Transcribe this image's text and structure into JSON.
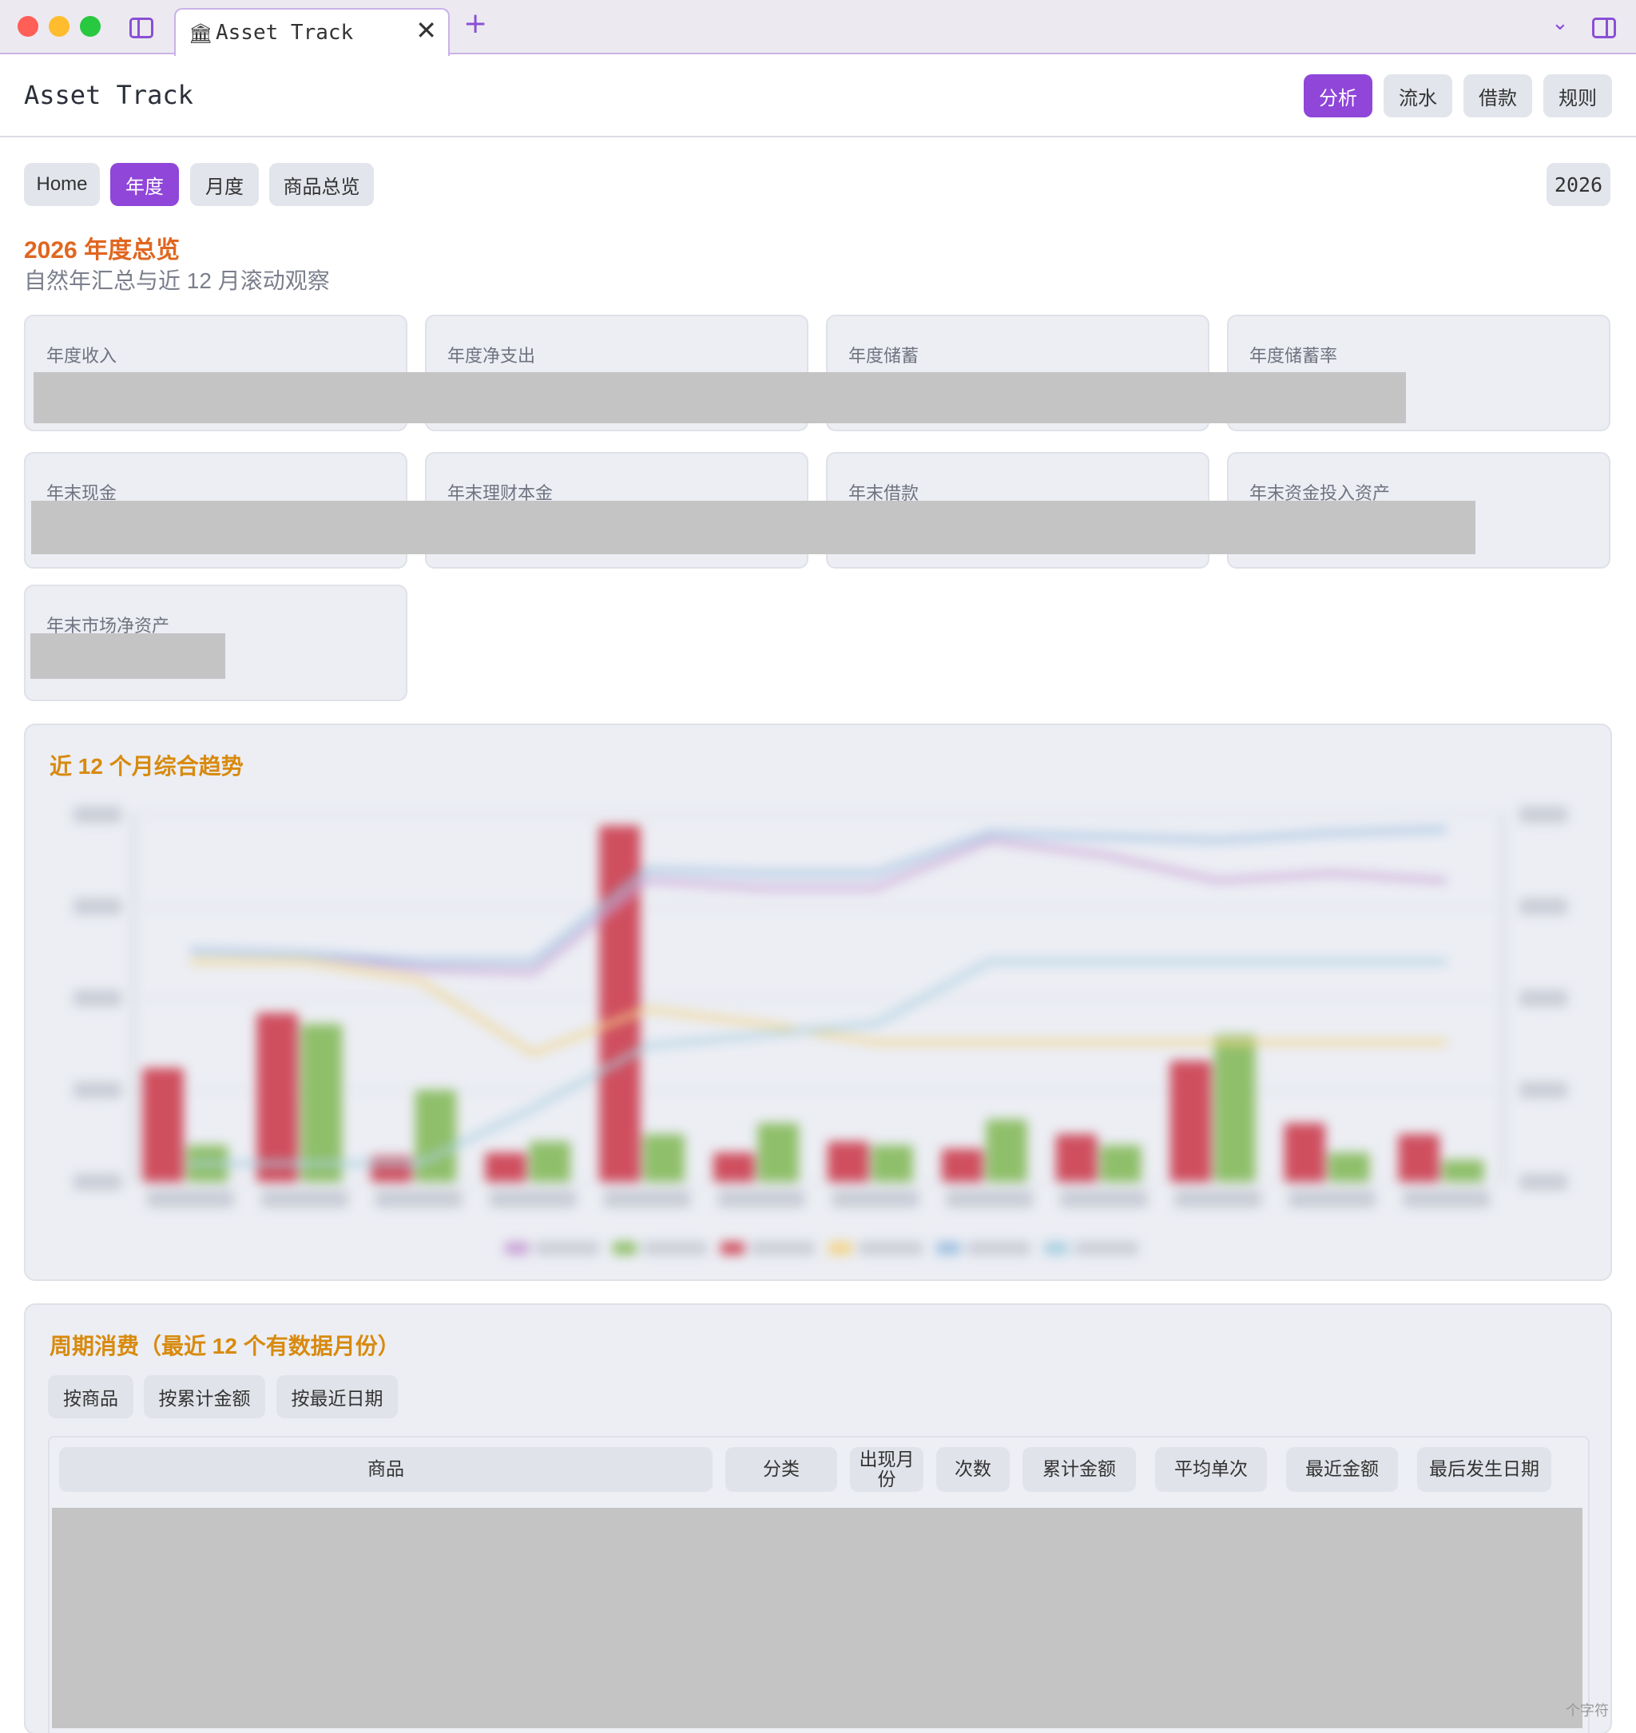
{
  "window": {
    "tab_title": "Asset Track",
    "tab_icon": "🏛",
    "close_glyph": "✕",
    "new_tab_glyph": "+",
    "chevron_glyph": "⌄"
  },
  "header": {
    "app_title": "Asset Track",
    "nav": [
      "分析",
      "流水",
      "借款",
      "规则"
    ],
    "active_nav": "分析"
  },
  "subnav": {
    "items": [
      "Home",
      "年度",
      "月度",
      "商品总览"
    ],
    "active": "年度",
    "year": "2026"
  },
  "page": {
    "title": "2026 年度总览",
    "subtitle": "自然年汇总与近 12 月滚动观察"
  },
  "stats": {
    "row1": [
      "年度收入",
      "年度净支出",
      "年度储蓄",
      "年度储蓄率"
    ],
    "row2": [
      "年末现金",
      "年末理财本金",
      "年末借款",
      "年末资金投入资产"
    ],
    "row3": [
      "年末市场净资产"
    ]
  },
  "trend": {
    "title": "近 12 个月综合趋势"
  },
  "colors": {
    "accent": "#8f46d9",
    "title_orange": "#e0661f",
    "panel_title": "#d88a0e",
    "bar_red": "#cf4f5f",
    "bar_green": "#8fbf6a",
    "line_purple": "#c9a3d6",
    "line_blue": "#9fc0e0",
    "line_yellow": "#f2d48a",
    "line_teal": "#a9cfe0"
  },
  "chart_data": {
    "type": "bar",
    "note_visible": false,
    "categories": [
      "",
      "",
      "",
      "",
      "",
      "",
      "",
      "",
      "",
      "",
      "",
      ""
    ],
    "series": [
      {
        "values": [
          0.31,
          0.46,
          0.07,
          0.08,
          0.97,
          0.08,
          0.11,
          0.09,
          0.13,
          0.33,
          0.16,
          0.13
        ]
      },
      {
        "values": [
          0.1,
          0.43,
          0.25,
          0.11,
          0.13,
          0.16,
          0.1,
          0.17,
          0.1,
          0.4,
          0.08,
          0.06
        ]
      }
    ],
    "lines": [
      {
        "values": [
          0.63,
          0.62,
          0.58,
          0.57,
          0.82,
          0.8,
          0.8,
          0.93,
          0.89,
          0.82,
          0.84,
          0.82
        ]
      },
      {
        "values": [
          0.63,
          0.62,
          0.6,
          0.6,
          0.85,
          0.84,
          0.84,
          0.95,
          0.94,
          0.93,
          0.95,
          0.96
        ]
      },
      {
        "values": [
          0.6,
          0.6,
          0.55,
          0.35,
          0.47,
          0.43,
          0.38,
          0.38,
          0.38,
          0.38,
          0.38,
          0.38
        ]
      },
      {
        "values": [
          0.05,
          0.05,
          0.05,
          0.2,
          0.37,
          0.4,
          0.43,
          0.6,
          0.6,
          0.6,
          0.6,
          0.6
        ]
      }
    ]
  },
  "consumption": {
    "title": "周期消费（最近 12 个有数据月份）",
    "sort_buttons": [
      "按商品",
      "按累计金额",
      "按最近日期"
    ],
    "columns": [
      "商品",
      "分类",
      "出现月份",
      "次数",
      "累计金额",
      "平均单次",
      "最近金额",
      "最后发生日期"
    ]
  },
  "watermark": "个字符"
}
